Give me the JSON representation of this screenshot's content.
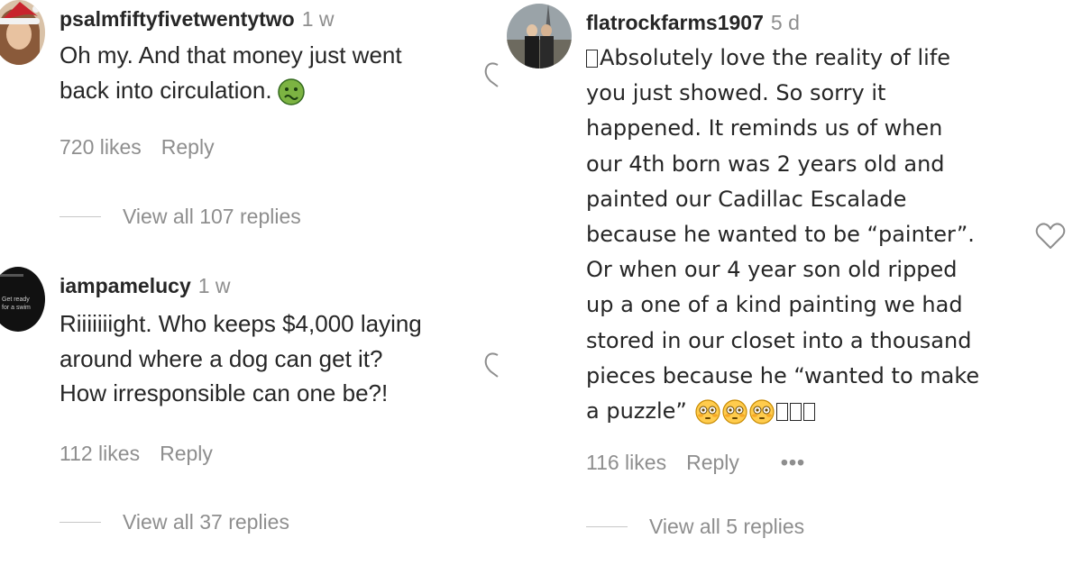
{
  "comments": [
    {
      "username": "psalmfiftyfivetwentytwo",
      "time": "1 w",
      "lines": [
        "Oh my. And that money just went",
        "back into circulation."
      ],
      "likes": "720 likes",
      "reply": "Reply",
      "view_replies": "View all 107 replies"
    },
    {
      "username": "iampamelucy",
      "time": "1 w",
      "lines": [
        "Riiiiiiight. Who keeps $4,000 laying",
        "around where a dog can get it?",
        "How irresponsible can one be?!"
      ],
      "likes": "112 likes",
      "reply": "Reply",
      "view_replies": "View all 37 replies"
    },
    {
      "username": "flatrockfarms1907",
      "time": "5 d",
      "lines": [
        "Absolutely love the reality of life",
        "you just showed. So sorry it",
        "happened. It reminds us of when",
        "our 4th born was 2 years old and",
        "painted our Cadillac Escalade",
        "because he wanted to be “painter”.",
        "Or when our 4 year son old ripped",
        "up a one of a kind painting we had",
        "stored in our closet into a thousand",
        "pieces because he “wanted to make",
        "a puzzle”"
      ],
      "likes": "116 likes",
      "reply": "Reply",
      "more": "•••",
      "view_replies": "View all 5 replies"
    }
  ],
  "avatar_text": "Get ready for a swimming"
}
